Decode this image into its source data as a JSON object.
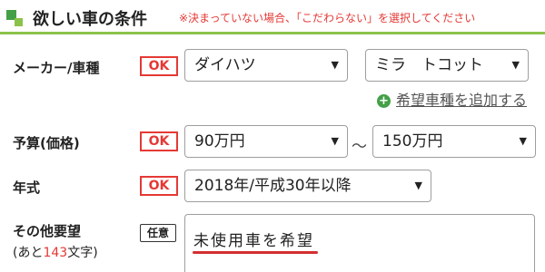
{
  "header": {
    "title": "欲しい車の条件",
    "note": "※決まっていない場合、「こだわらない」を選択してください",
    "accent_color": "#8bc34a",
    "icon": "green-squares-icon"
  },
  "maker": {
    "label": "メーカー/車種",
    "badge": "OK",
    "maker_value": "ダイハツ",
    "model_value": "ミラ　トコット",
    "add_link": "希望車種を追加する",
    "add_icon": "plus-circle-icon"
  },
  "budget": {
    "label": "予算(価格)",
    "badge": "OK",
    "min_value": "90万円",
    "separator": "～",
    "max_value": "150万円"
  },
  "year": {
    "label": "年式",
    "badge": "OK",
    "value": "2018年/平成30年以降"
  },
  "other": {
    "label": "その他要望",
    "badge": "任意",
    "sub_label_prefix": "(あと",
    "remaining": "143",
    "sub_label_suffix": "文字)",
    "text": "未使用車を希望"
  },
  "colors": {
    "ok_red": "#e53935",
    "underline_red": "#d32f2f",
    "plus_green": "#43a047"
  }
}
